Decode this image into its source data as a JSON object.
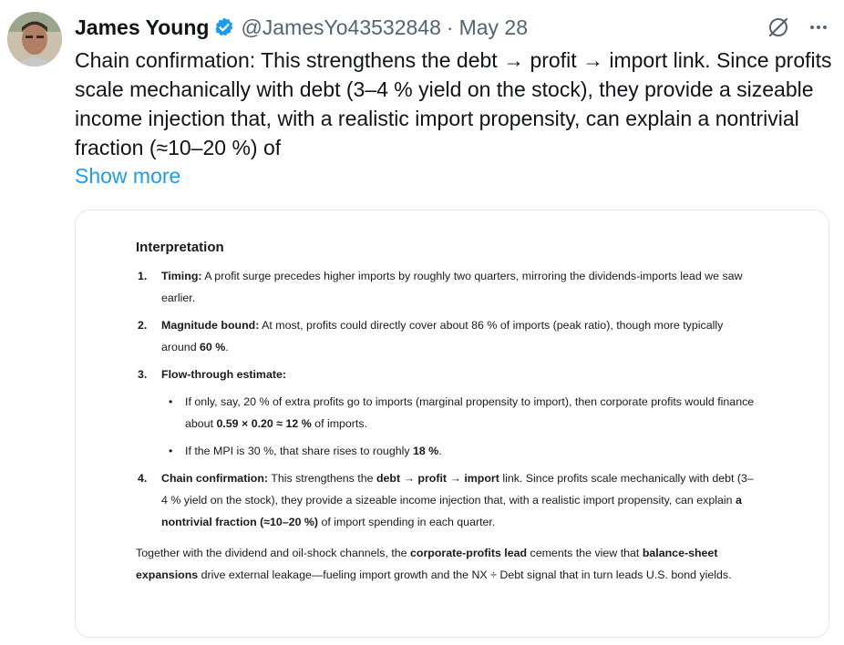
{
  "author": {
    "name": "James Young",
    "handle": "@JamesYo43532848",
    "separator": "·",
    "date": "May 28"
  },
  "icons": {
    "verified": "verified-badge-icon",
    "grok": "grok-icon",
    "more": "more-icon"
  },
  "colors": {
    "link": "#1d9bf0",
    "verified": "#1d9bf0",
    "text": "#0f1419",
    "muted": "#536471"
  },
  "tweet": {
    "text": "Chain confirmation: This strengthens the debt → profit → import link. Since profits scale mechanically with debt (3–4 % yield on the stock), they provide a sizeable income injection that, with a realistic import propensity, can explain a nontrivial fraction (≈10–20 %) of",
    "show_more": "Show more"
  },
  "card": {
    "heading": "Interpretation",
    "items": [
      {
        "num": "1.",
        "bold": "Timing:",
        "text": " A profit surge precedes higher imports by roughly two quarters, mirroring the dividends-imports lead we saw earlier."
      },
      {
        "num": "2.",
        "bold": "Magnitude bound:",
        "text": " At most, profits could directly cover about 86 % of imports (peak ratio), though more typically around ",
        "bold2": "60 %",
        "text2": "."
      },
      {
        "num": "3.",
        "bold": "Flow-through estimate:",
        "subs": [
          {
            "text": "If only, say, 20 % of extra profits go to imports (marginal propensity to import), then corporate profits would finance about ",
            "bold": "0.59 × 0.20 ≈ 12 %",
            "text2": " of imports."
          },
          {
            "text": "If the MPI is 30 %, that share rises to roughly ",
            "bold": "18 %",
            "text2": "."
          }
        ]
      },
      {
        "num": "4.",
        "bold": "Chain confirmation:",
        "t1": " This strengthens the ",
        "b1": "debt → profit → import",
        "t2": " link. Since profits scale mechanically with debt (3–4 % yield on the stock), they provide a sizeable income injection that, with a realistic import propensity, can explain ",
        "b2": "a nontrivial fraction (≈10–20 %)",
        "t3": " of import spending in each quarter."
      }
    ],
    "closing": {
      "t1": "Together with the dividend and oil-shock channels, the ",
      "b1": "corporate-profits lead",
      "t2": " cements the view that ",
      "b2": "balance-sheet expansions",
      "t3": " drive external leakage—fueling import growth and the NX ÷ Debt signal that in turn leads U.S. bond yields."
    }
  }
}
